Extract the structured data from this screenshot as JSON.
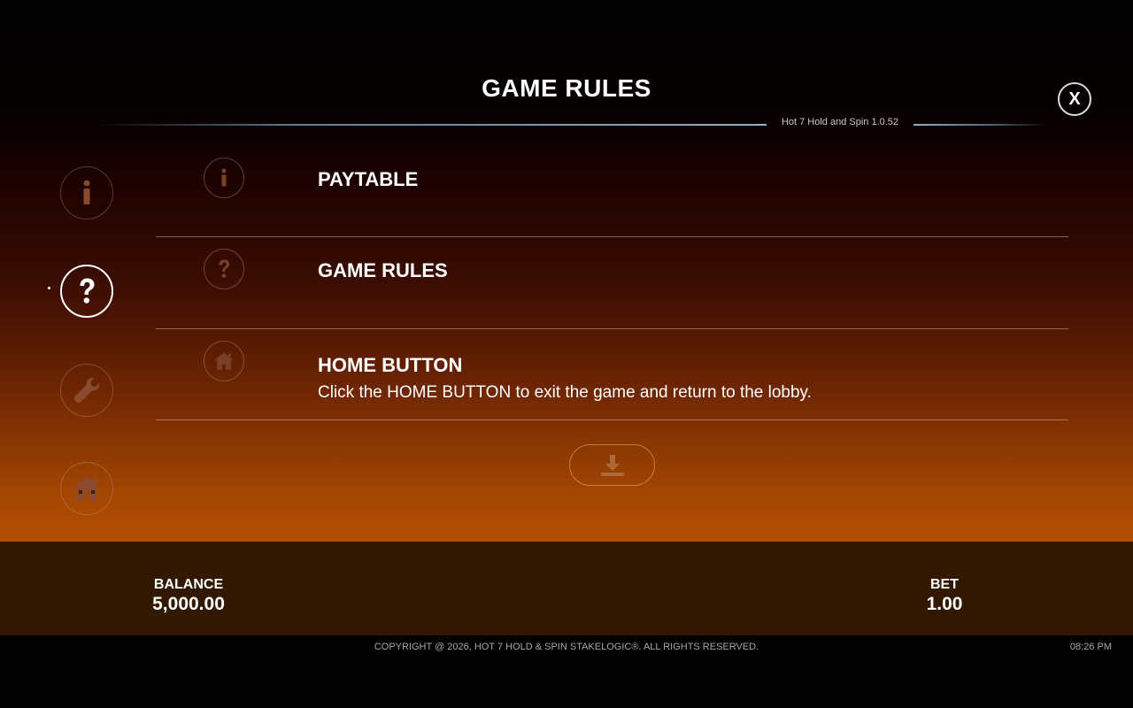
{
  "header": {
    "title": "GAME RULES",
    "version": "Hot 7 Hold and Spin 1.0.52",
    "close_label": "X"
  },
  "sidebar": {
    "items": [
      {
        "name": "info",
        "icon": "info-icon",
        "active": false
      },
      {
        "name": "game-rules",
        "icon": "question-icon",
        "active": true
      },
      {
        "name": "settings",
        "icon": "wrench-icon",
        "active": false
      },
      {
        "name": "home",
        "icon": "home-icon",
        "active": false
      }
    ]
  },
  "rules": [
    {
      "icon": "info-icon",
      "title": "PAYTABLE",
      "description": ""
    },
    {
      "icon": "question-icon",
      "title": "GAME RULES",
      "description": ""
    },
    {
      "icon": "home-icon",
      "title": "HOME BUTTON",
      "description": "Click the HOME BUTTON to exit the game and return to the lobby."
    }
  ],
  "download": {
    "icon": "download-icon"
  },
  "footer": {
    "balance_label": "BALANCE",
    "balance_value": "5,000.00",
    "bet_label": "BET",
    "bet_value": "1.00",
    "copyright": "COPYRIGHT @ 2026, HOT 7 HOLD & SPIN STAKELOGIC®. ALL RIGHTS RESERVED.",
    "time": "08:26 PM"
  },
  "colors": {
    "accent_icon": "#8a4a30",
    "footer_bg": "#331800",
    "gradient_bottom": "#b44f00"
  }
}
